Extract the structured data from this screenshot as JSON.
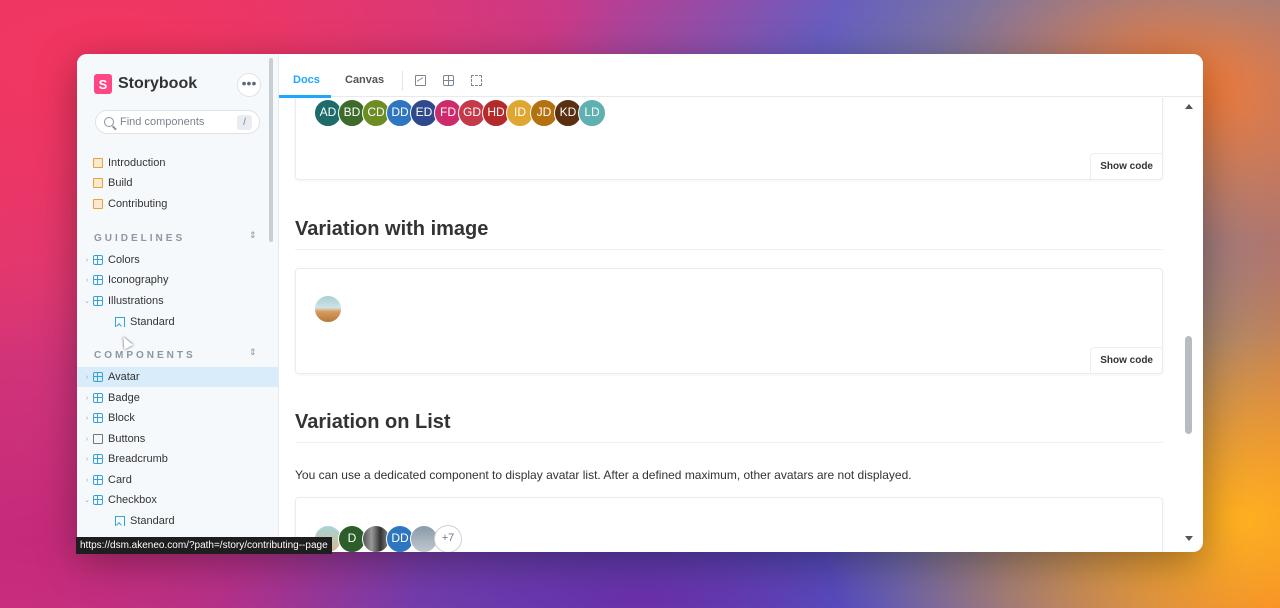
{
  "sidebar": {
    "brand": "Storybook",
    "logo_letter": "S",
    "menu_label": "•••",
    "search_placeholder": "Find components",
    "search_shortcut": "/",
    "top_items": [
      {
        "label": "Introduction"
      },
      {
        "label": "Build"
      },
      {
        "label": "Contributing"
      }
    ],
    "sections": [
      {
        "title": "GUIDELINES",
        "items": [
          {
            "label": "Colors",
            "type": "component"
          },
          {
            "label": "Iconography",
            "type": "component"
          },
          {
            "label": "Illustrations",
            "type": "component"
          },
          {
            "label": "Standard",
            "type": "story"
          }
        ]
      },
      {
        "title": "COMPONENTS",
        "items": [
          {
            "label": "Avatar",
            "type": "component",
            "selected": true
          },
          {
            "label": "Badge",
            "type": "component"
          },
          {
            "label": "Block",
            "type": "component"
          },
          {
            "label": "Buttons",
            "type": "folder"
          },
          {
            "label": "Breadcrumb",
            "type": "component"
          },
          {
            "label": "Card",
            "type": "component"
          },
          {
            "label": "Checkbox",
            "type": "component"
          },
          {
            "label": "Standard",
            "type": "story"
          }
        ]
      }
    ]
  },
  "toolbar": {
    "tabs": [
      "Docs",
      "Canvas"
    ],
    "active_tab": "Docs"
  },
  "docs": {
    "avatar_group": [
      "AD",
      "BD",
      "CD",
      "DD",
      "ED",
      "FD",
      "GD",
      "HD",
      "ID",
      "JD",
      "KD",
      "LD"
    ],
    "avatar_colors": [
      "#1d6b6b",
      "#3d6b2a",
      "#6b8d22",
      "#2e76c0",
      "#2f4a8c",
      "#cc2a6a",
      "#c43a4a",
      "#b42a2a",
      "#e0a630",
      "#b5710f",
      "#5a3010",
      "#5fb0b0"
    ],
    "show_code": "Show code",
    "section_image_title": "Variation with image",
    "section_list_title": "Variation on List",
    "section_list_description": "You can use a dedicated component to display avatar list. After a defined maximum, other avatars are not displayed.",
    "list_avatars": [
      "",
      "D",
      "",
      "DD",
      ""
    ],
    "list_more": "+7"
  },
  "status_bar": {
    "url": "https://dsm.akeneo.com/?path=/story/contributing--page"
  }
}
